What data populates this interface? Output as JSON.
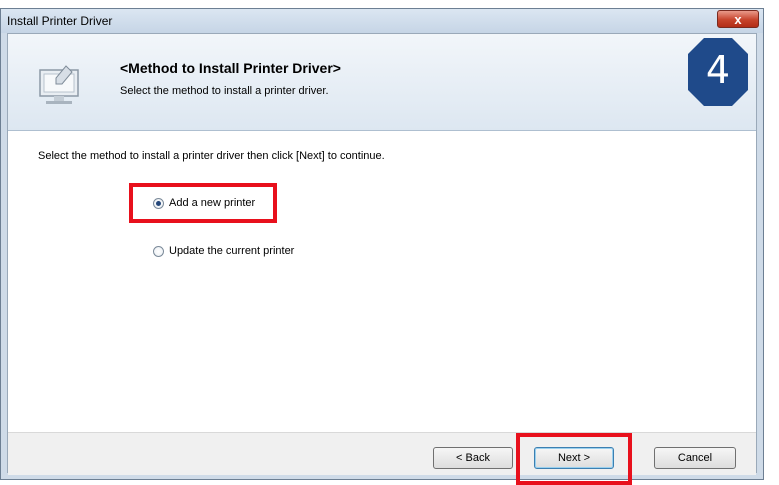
{
  "window": {
    "title": "Install Printer Driver",
    "close_label": "x"
  },
  "header": {
    "title": "<Method to Install Printer Driver>",
    "subtitle": "Select the method to install a printer driver.",
    "icon": "monitor-install-icon",
    "step_number": "4"
  },
  "main": {
    "instruction": "Select the method to install a printer driver then click [Next] to continue.",
    "options": [
      {
        "label": "Add a new printer",
        "selected": true
      },
      {
        "label": "Update the current printer",
        "selected": false
      }
    ]
  },
  "footer": {
    "back_label": "< Back",
    "next_label": "Next >",
    "cancel_label": "Cancel"
  },
  "colors": {
    "highlight": "#e8101c",
    "badge": "#1f4a8a"
  }
}
